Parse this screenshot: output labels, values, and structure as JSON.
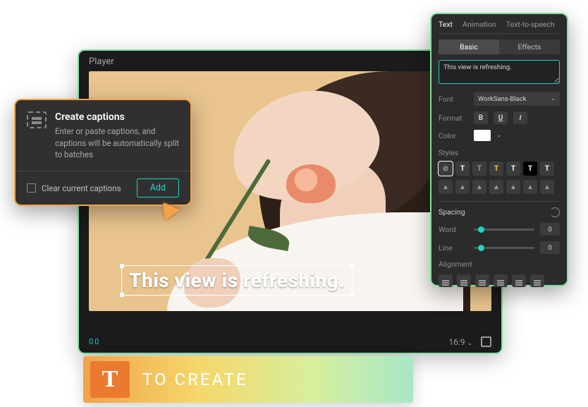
{
  "player": {
    "title": "Player",
    "caption_text": "This view is refreshing.",
    "time": "00",
    "aspect": "16:9"
  },
  "popover": {
    "heading": "Create captions",
    "body": "Enter or paste captions, and captions will be automatically split to batches",
    "clear_label": "Clear current captions",
    "add_label": "Add"
  },
  "panel": {
    "tabs": {
      "text": "Text",
      "animation": "Animation",
      "tts": "Text-to-speech"
    },
    "subtabs": {
      "basic": "Basic",
      "effects": "Effects"
    },
    "textarea_value": "This view is refreshing.",
    "font_label": "Font",
    "font_value": "WorkSans-Black",
    "format_label": "Format",
    "format": {
      "bold": "B",
      "underline": "U",
      "italic": "I"
    },
    "color_label": "Color",
    "styles_label": "Styles",
    "style_glyphs": [
      "⊘",
      "T",
      "T",
      "T",
      "T",
      "T",
      "T"
    ],
    "spacing_label": "Spacing",
    "word_label": "Word",
    "word_value": "0",
    "line_label": "Line",
    "line_value": "0",
    "alignment_label": "Alignment"
  },
  "bottom": {
    "badge": "T",
    "label": "TO CREATE"
  }
}
